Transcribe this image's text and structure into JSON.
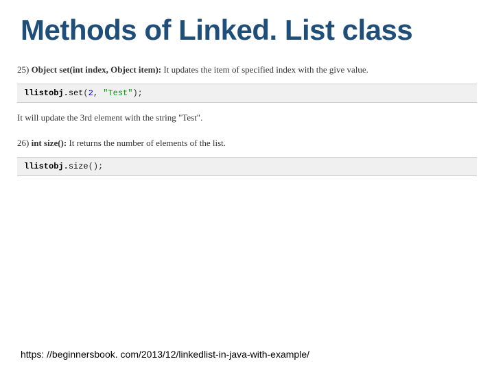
{
  "title": "Methods of Linked. List class",
  "methods": [
    {
      "number": "25)",
      "signature": "Object set(int index, Object item):",
      "description": " It updates the item of specified index with the give value.",
      "code_obj": "llistobj.",
      "code_call": "set",
      "code_open": "(",
      "code_arg_num": "2",
      "code_sep": ", ",
      "code_arg_str": "\"Test\"",
      "code_close": ");",
      "explanation": "It will update the 3rd element with the string \"Test\"."
    },
    {
      "number": "26)",
      "signature": "int size():",
      "description": " It returns the number of elements of the list.",
      "code_obj": "llistobj.",
      "code_call": "size",
      "code_open": "();",
      "code_arg_num": "",
      "code_sep": "",
      "code_arg_str": "",
      "code_close": "",
      "explanation": ""
    }
  ],
  "footer_url": "https: //beginnersbook. com/2013/12/linkedlist-in-java-with-example/"
}
